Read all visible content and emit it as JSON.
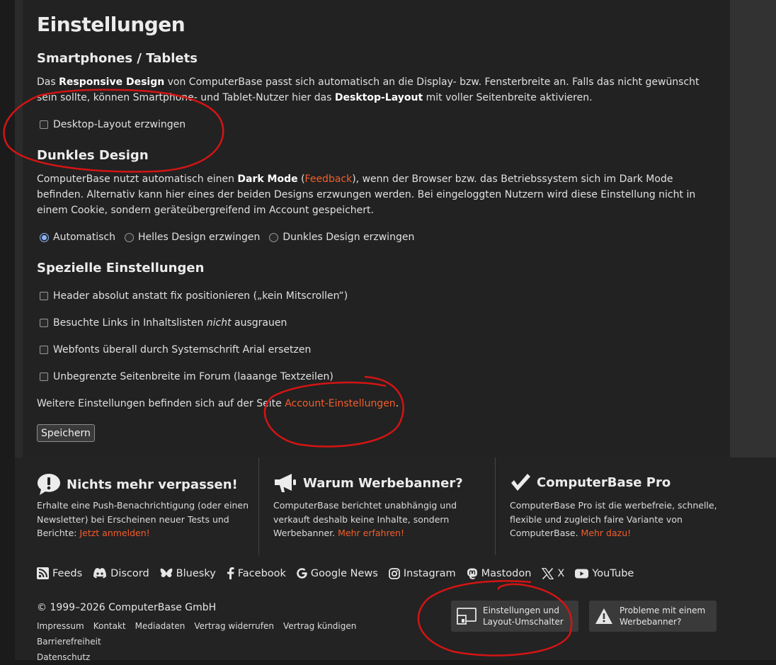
{
  "page_title": "Einstellungen",
  "sections": {
    "smartphones": {
      "heading": "Smartphones / Tablets",
      "text_1": "Das ",
      "text_bold_1": "Responsive Design",
      "text_2": " von ComputerBase passt sich automatisch an die Display- bzw. Fensterbreite an. Falls das nicht gewünscht sein sollte, können Smartphone- und Tablet-Nutzer hier das ",
      "text_bold_2": "Desktop-Layout",
      "text_3": " mit voller Seitenbreite aktivieren.",
      "checkbox_label": "Desktop-Layout erzwingen"
    },
    "dark": {
      "heading": "Dunkles Design",
      "text_1": "ComputerBase nutzt automatisch einen ",
      "text_bold": "Dark Mode",
      "text_2": " (",
      "feedback_link": "Feedback",
      "text_3": "), wenn der Browser bzw. das Betriebssystem sich im Dark Mode befinden. Alternativ kann hier eines der beiden Designs erzwungen werden. Bei eingeloggten Nutzern wird diese Einstellung nicht in einem Cookie, sondern geräteübergreifend im Account gespeichert.",
      "radio_auto": "Automatisch",
      "radio_light": "Helles Design erzwingen",
      "radio_dark": "Dunkles Design erzwingen"
    },
    "special": {
      "heading": "Spezielle Einstellungen",
      "opt_header": "Header absolut anstatt fix positionieren („kein Mitscrollen“)",
      "opt_links_1": "Besuchte Links in Inhaltslisten ",
      "opt_links_em": "nicht",
      "opt_links_2": " ausgrauen",
      "opt_fonts": "Webfonts überall durch Systemschrift Arial ersetzen",
      "opt_width": "Unbegrenzte Seitenbreite im Forum (laaange Textzeilen)",
      "more_text": "Weitere Einstellungen befinden sich auf der Seite ",
      "account_link": "Account-Einstellungen",
      "more_end": ".",
      "save_label": "Speichern"
    }
  },
  "footer": {
    "col1": {
      "title": "Nichts mehr verpassen!",
      "text": "Erhalte eine Push-Benachrichtigung (oder einen Newsletter) bei Erscheinen neuer Tests und Berichte: ",
      "link": "Jetzt anmelden!"
    },
    "col2": {
      "title": "Warum Werbebanner?",
      "text": "ComputerBase berichtet unabhängig und verkauft deshalb keine Inhalte, sondern Werbebanner. ",
      "link": "Mehr erfahren!"
    },
    "col3": {
      "title": "ComputerBase Pro",
      "text": "ComputerBase Pro ist die werbefreie, schnelle, flexible und zugleich faire Variante von ComputerBase. ",
      "link": "Mehr dazu!"
    },
    "social": {
      "feeds": "Feeds",
      "discord": "Discord",
      "bluesky": "Bluesky",
      "facebook": "Facebook",
      "google_news": "Google News",
      "instagram": "Instagram",
      "mastodon": "Mastodon",
      "x": "X",
      "youtube": "YouTube"
    },
    "copyright": "© 1999–2026 ComputerBase GmbH",
    "links": {
      "impressum": "Impressum",
      "kontakt": "Kontakt",
      "mediadaten": "Mediadaten",
      "widerrufen": "Vertrag widerrufen",
      "kuendigen": "Vertrag kündigen",
      "barrierefreiheit": "Barrierefreiheit",
      "datenschutz": "Datenschutz"
    },
    "settings_button_line1": "Einstellungen und",
    "settings_button_line2": "Layout-Umschalter",
    "problem_button_line1": "Probleme mit einem",
    "problem_button_line2": "Werbebanner?"
  },
  "colors": {
    "accent_link": "#f35d2b",
    "annotation": "#d41414"
  }
}
